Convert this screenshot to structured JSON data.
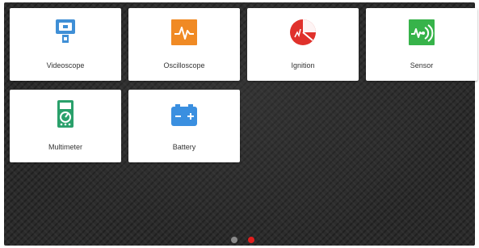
{
  "apps": [
    {
      "label": "Videoscope",
      "icon": "videoscope-icon"
    },
    {
      "label": "Oscilloscope",
      "icon": "oscilloscope-icon"
    },
    {
      "label": "Ignition",
      "icon": "ignition-icon"
    },
    {
      "label": "Sensor",
      "icon": "sensor-icon"
    },
    {
      "label": "Multimeter",
      "icon": "multimeter-icon"
    },
    {
      "label": "Battery",
      "icon": "battery-icon"
    }
  ],
  "pagination": {
    "pages": 2,
    "current": 2
  },
  "colors": {
    "videoscope": "#3f8fd6",
    "oscilloscope": "#f08a24",
    "ignition": "#e0312b",
    "sensor": "#37b34a",
    "multimeter": "#2aa06b",
    "battery": "#3a8fe0",
    "dot_active": "#e21d1d",
    "dot_inactive": "#8a8a8a"
  }
}
